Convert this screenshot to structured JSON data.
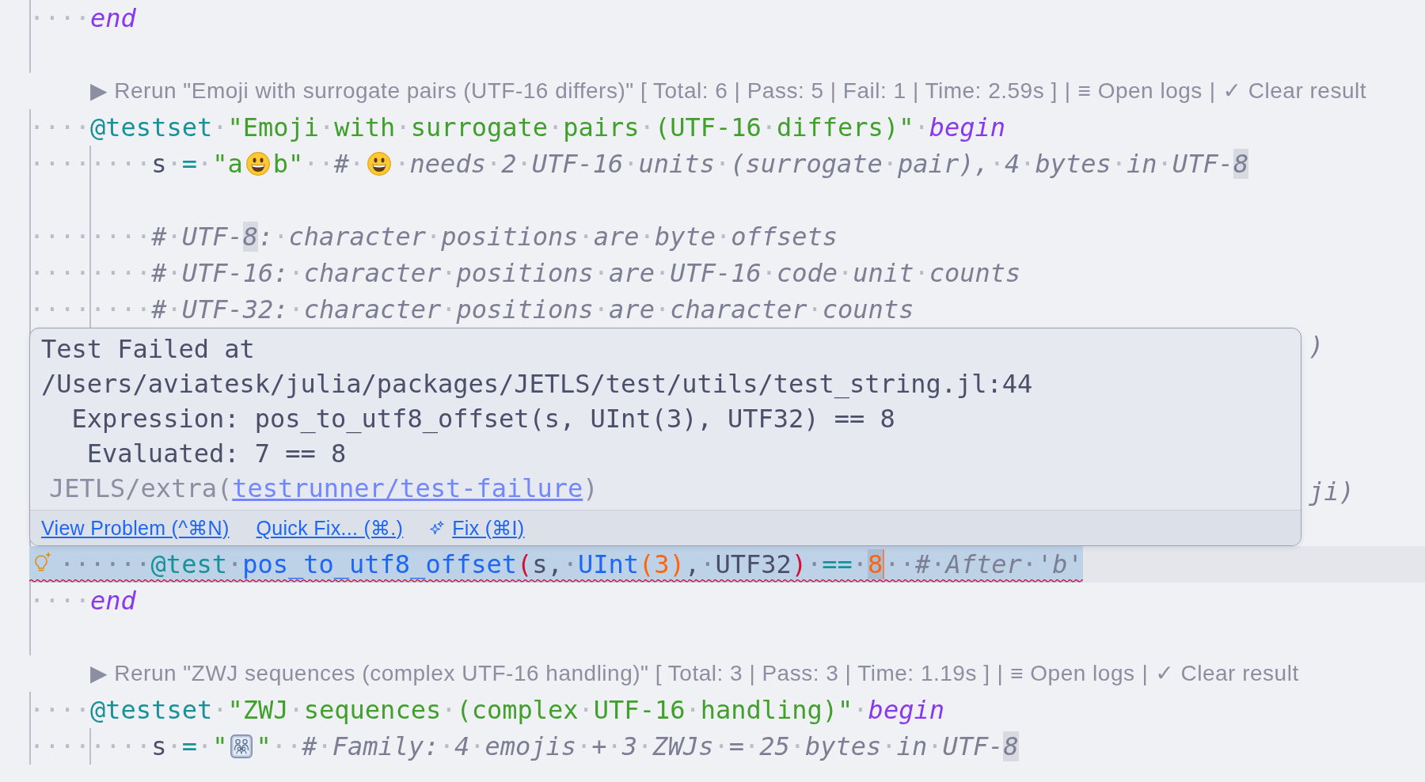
{
  "editor": {
    "lines": [
      {
        "kind": "code",
        "tokens": [
          {
            "text": "····",
            "kind": "plain"
          },
          {
            "text": "end",
            "kind": "keyword"
          }
        ]
      },
      {
        "kind": "blank"
      },
      {
        "kind": "lens",
        "links": [
          "▶ Rerun \"Emoji with surrogate pairs (UTF-16 differs)\" [ Total: 6 | Pass: 5 | Fail: 1 | Time: 2.59s ]",
          "≡ Open logs",
          "✓ Clear result"
        ],
        "separators": [
          "|",
          "|"
        ]
      },
      {
        "kind": "code",
        "tokens": [
          {
            "text": "····",
            "kind": "plain"
          },
          {
            "text": "@testset",
            "kind": "macro"
          },
          {
            "text": "·",
            "kind": "plain"
          },
          {
            "text": "\"Emoji·with·surrogate·pairs·(UTF-16·differs)\"",
            "kind": "string"
          },
          {
            "text": "·",
            "kind": "plain"
          },
          {
            "text": "begin",
            "kind": "keyword"
          }
        ]
      },
      {
        "kind": "block",
        "children": [
          {
            "kind": "code",
            "tokens": [
              {
                "text": "········s·",
                "kind": "plain"
              },
              {
                "text": "=",
                "kind": "operator"
              },
              {
                "text": "·",
                "kind": "plain"
              },
              {
                "text": "\"a",
                "kind": "string"
              },
              {
                "kind": "smiley"
              },
              {
                "text": "b\"",
                "kind": "string"
              },
              {
                "text": "··",
                "kind": "plain"
              },
              {
                "text": "#·",
                "kind": "comment"
              },
              {
                "kind": "smiley"
              },
              {
                "text": "·needs·2·UTF-16·units·(surrogate·pair),·4·bytes·in·UTF-",
                "kind": "comment"
              },
              {
                "text": "8",
                "kind": "match"
              }
            ]
          },
          {
            "kind": "blank"
          },
          {
            "kind": "code",
            "tokens": [
              {
                "text": "········",
                "kind": "plain"
              },
              {
                "text": "#·UTF-",
                "kind": "comment"
              },
              {
                "text": "8",
                "kind": "match"
              },
              {
                "text": ":·character·positions·are·byte·offsets",
                "kind": "comment"
              }
            ]
          },
          {
            "kind": "code",
            "tokens": [
              {
                "text": "········",
                "kind": "plain"
              },
              {
                "text": "#·UTF-16:·character·positions·are·UTF-16·code·unit·counts",
                "kind": "comment"
              }
            ]
          },
          {
            "kind": "code",
            "tokens": [
              {
                "text": "········",
                "kind": "plain"
              },
              {
                "text": "#·UTF-32:·character·positions·are·character·counts",
                "kind": "comment"
              }
            ]
          },
          {
            "kind": "hidden",
            "tail": ")"
          },
          {
            "kind": "hidden"
          },
          {
            "kind": "hidden"
          },
          {
            "kind": "hidden"
          },
          {
            "kind": "hidden",
            "tail": "ji)"
          },
          {
            "kind": "hidden"
          },
          {
            "kind": "active",
            "tokens": [
              {
                "kind": "bulb"
              },
              {
                "text": "······",
                "kind": "plain"
              },
              {
                "text": "@test",
                "kind": "macro"
              },
              {
                "text": "·",
                "kind": "plain"
              },
              {
                "text": "pos_to_utf8_offset",
                "kind": "function"
              },
              {
                "text": "(",
                "kind": "bracket"
              },
              {
                "text": "s,·",
                "kind": "plain"
              },
              {
                "text": "UInt",
                "kind": "function"
              },
              {
                "text": "(",
                "kind": "nested"
              },
              {
                "text": "3",
                "kind": "number"
              },
              {
                "text": ")",
                "kind": "nested"
              },
              {
                "text": ",·UTF32",
                "kind": "plain"
              },
              {
                "text": ")",
                "kind": "bracket"
              },
              {
                "text": "·",
                "kind": "plain"
              },
              {
                "text": "==",
                "kind": "operator"
              },
              {
                "text": "·",
                "kind": "plain"
              },
              {
                "text": "8",
                "kind": "hit"
              },
              {
                "kind": "caret"
              },
              {
                "text": "··",
                "kind": "plain"
              },
              {
                "text": "#·After·'b'",
                "kind": "comment"
              }
            ]
          }
        ]
      },
      {
        "kind": "code",
        "tokens": [
          {
            "text": "····",
            "kind": "plain"
          },
          {
            "text": "end",
            "kind": "keyword"
          }
        ]
      },
      {
        "kind": "blank"
      },
      {
        "kind": "lens",
        "links": [
          "▶ Rerun \"ZWJ sequences (complex UTF-16 handling)\" [ Total: 3 | Pass: 3 | Time: 1.19s ]",
          "≡ Open logs",
          "✓ Clear result"
        ],
        "separators": [
          "|",
          "|"
        ]
      },
      {
        "kind": "code",
        "tokens": [
          {
            "text": "····",
            "kind": "plain"
          },
          {
            "text": "@testset",
            "kind": "macro"
          },
          {
            "text": "·",
            "kind": "plain"
          },
          {
            "text": "\"ZWJ·sequences·(complex·UTF-16·handling)\"",
            "kind": "string"
          },
          {
            "text": "·",
            "kind": "plain"
          },
          {
            "text": "begin",
            "kind": "keyword"
          }
        ]
      },
      {
        "kind": "block",
        "children": [
          {
            "kind": "code",
            "tokens": [
              {
                "text": "········s·",
                "kind": "plain"
              },
              {
                "text": "=",
                "kind": "operator"
              },
              {
                "text": "·",
                "kind": "plain"
              },
              {
                "text": "\"",
                "kind": "string"
              },
              {
                "kind": "family"
              },
              {
                "text": "\"",
                "kind": "string"
              },
              {
                "text": "··",
                "kind": "plain"
              },
              {
                "text": "#·Family:·4·emojis·+·3·ZWJs·=·25·bytes·in·UTF-",
                "kind": "comment"
              },
              {
                "text": "8",
                "kind": "match"
              }
            ]
          }
        ]
      }
    ]
  },
  "hover_popup": {
    "message": "Test Failed at\n/Users/aviatesk/julia/packages/JETLS/test/utils/test_string.jl:44\n  Expression: pos_to_utf8_offset(s, UInt(3), UTF32) == 8\n   Evaluated: 7 == 8",
    "source": {
      "prefix": "JETLS/extra(",
      "link": "testrunner/test-failure",
      "suffix": ")"
    },
    "actions": [
      {
        "kind": "command",
        "label": "View Problem (^⌘N)"
      },
      {
        "kind": "command",
        "label": "Quick Fix... (⌘.)"
      },
      {
        "kind": "assist",
        "label": "Fix (⌘I)"
      }
    ]
  }
}
